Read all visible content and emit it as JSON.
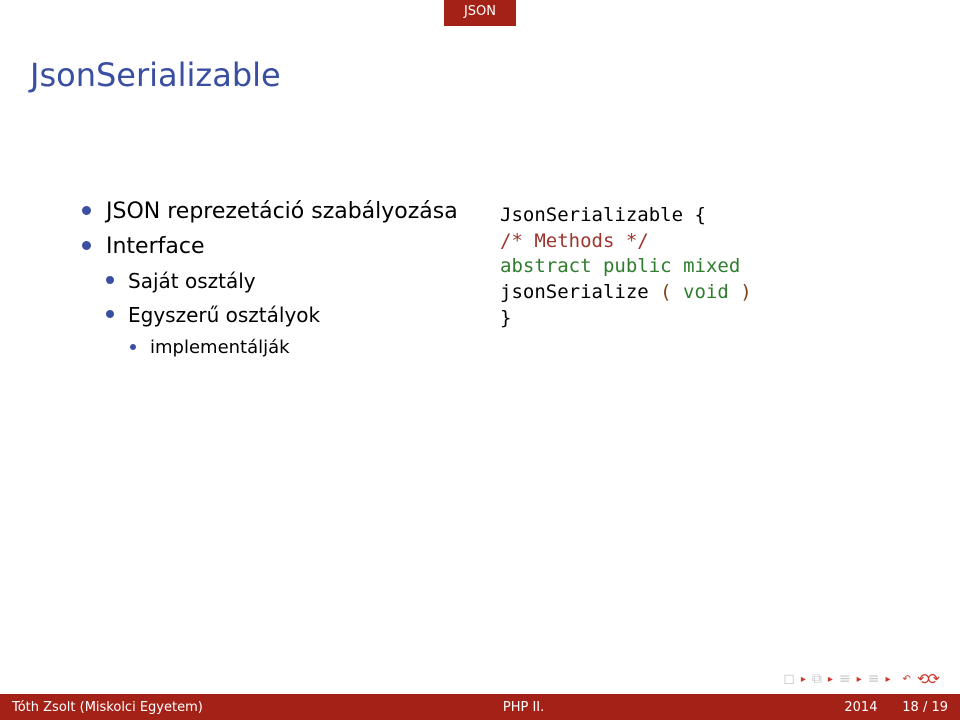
{
  "tab": {
    "label": "JSON"
  },
  "title": "JsonSerializable",
  "bullets": {
    "b1": "JSON reprezetáció szabályozása",
    "b2": "Interface",
    "b3": "Saját osztály",
    "b4": "Egyszerű osztályok",
    "b4_1": "implementálják"
  },
  "code": {
    "l1_ident": "JsonSerializable",
    "l1_brace": " {",
    "l2_comment": "/* Methods */",
    "l3_kw1": "abstract",
    "l3_kw2": "public",
    "l3_type": "mixed",
    "l4_func": "jsonSerialize",
    "l4_paren_o": " ( ",
    "l4_void": "void",
    "l4_paren_c": " )",
    "l5_brace": "}"
  },
  "footer": {
    "author": "Tóth Zsolt (Miskolci Egyetem)",
    "center": "PHP II.",
    "year": "2014",
    "page": "18 / 19"
  }
}
